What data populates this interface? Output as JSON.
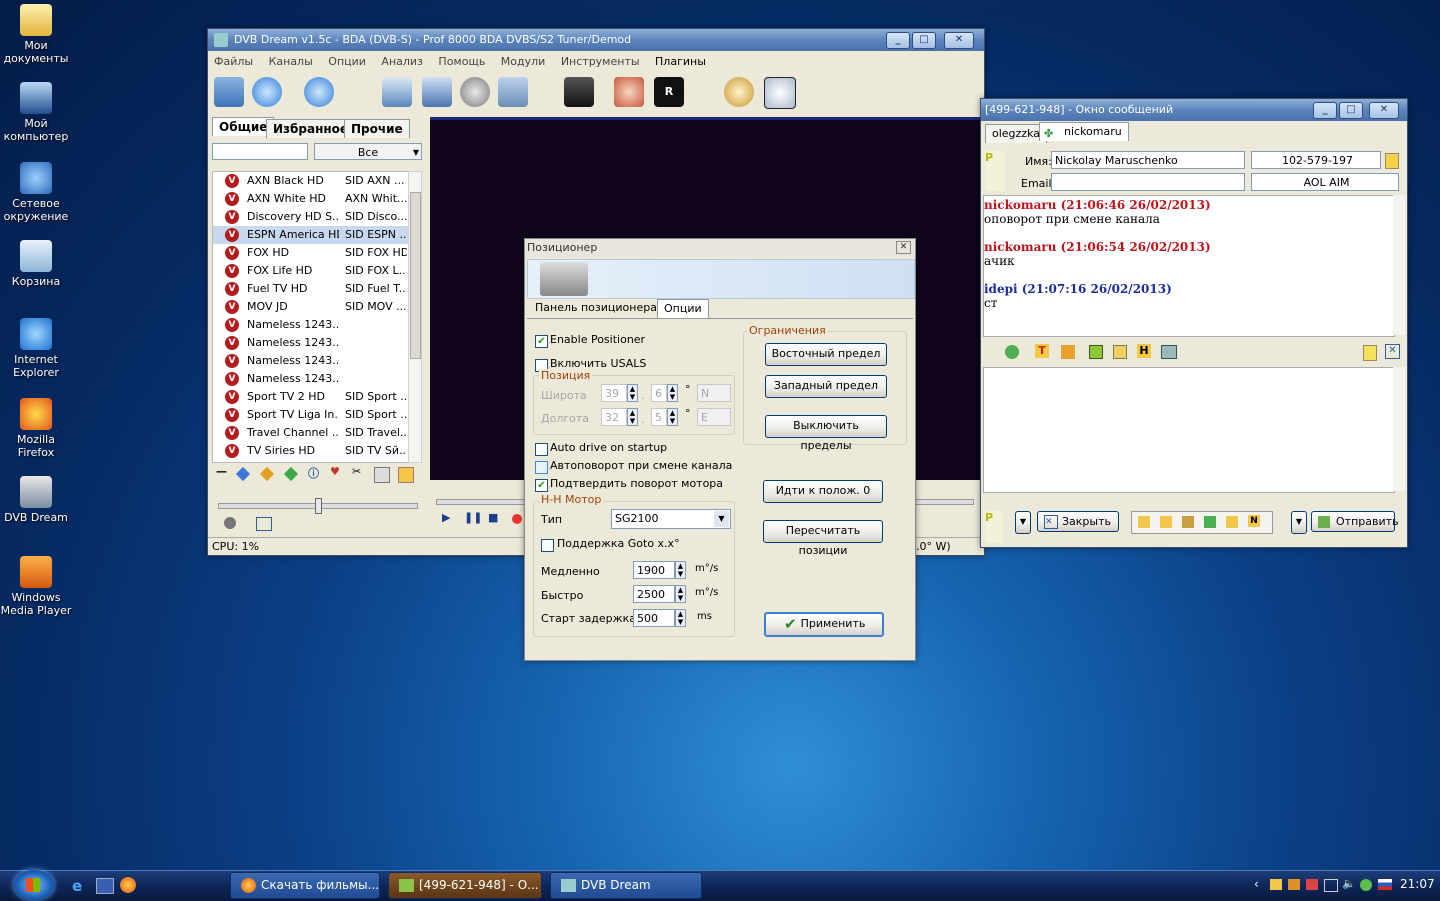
{
  "desktop": {
    "icons": [
      {
        "label": "Мои документы",
        "icon": "folder-icon"
      },
      {
        "label": "Мой компьютер",
        "icon": "computer-icon"
      },
      {
        "label": "Сетевое окружение",
        "icon": "network-icon"
      },
      {
        "label": "Корзина",
        "icon": "recycle-bin-icon"
      },
      {
        "label": "Internet Explorer",
        "icon": "internet-explorer-icon"
      },
      {
        "label": "Mozilla Firefox",
        "icon": "firefox-icon"
      },
      {
        "label": "DVB Dream",
        "icon": "satellite-icon"
      },
      {
        "label": "Windows Media Player",
        "icon": "media-player-icon"
      }
    ]
  },
  "dvb": {
    "title": "DVB Dream v1.5c - BDA (DVB-S) - Prof 8000 BDA DVBS/S2 Tuner/Demod",
    "menu": [
      "Файлы",
      "Каналы",
      "Опции",
      "Анализ",
      "Помощь",
      "Модули",
      "Инструменты",
      "Плагины"
    ],
    "tabs": [
      "Общие",
      "Избранное",
      "Прочие"
    ],
    "filter_value": "Все",
    "channels": [
      {
        "name": "AXN Black HD",
        "sid": "SID AXN ..."
      },
      {
        "name": "AXN White HD",
        "sid": "AXN Whit..."
      },
      {
        "name": "Discovery HD S...",
        "sid": "SID Disco..."
      },
      {
        "name": "ESPN America HD",
        "sid": "SID ESPN ..."
      },
      {
        "name": "FOX HD",
        "sid": "SID FOX HD"
      },
      {
        "name": "FOX Life HD",
        "sid": "SID FOX L..."
      },
      {
        "name": "Fuel TV HD",
        "sid": "SID Fuel T..."
      },
      {
        "name": "MOV JD",
        "sid": "SID MOV ..."
      },
      {
        "name": "Nameless 1243...",
        "sid": ""
      },
      {
        "name": "Nameless 1243...",
        "sid": ""
      },
      {
        "name": "Nameless 1243...",
        "sid": ""
      },
      {
        "name": "Nameless 1243...",
        "sid": ""
      },
      {
        "name": "Sport TV 2 HD",
        "sid": "SID Sport ..."
      },
      {
        "name": "Sport TV Liga In...",
        "sid": "SID Sport ..."
      },
      {
        "name": "Travel Channel ...",
        "sid": "SID Travel..."
      },
      {
        "name": "TV Siries HD",
        "sid": "SID TV Sй..."
      }
    ],
    "selected_index": 3,
    "status_cpu": "CPU: 1%",
    "status_right": ".0° W)"
  },
  "positioner": {
    "title": "Позиционер",
    "tabs": [
      "Панель позиционера",
      "Опции"
    ],
    "enable_positioner": "Enable Positioner",
    "usals": "Включить USALS",
    "position_group": "Позиция",
    "lat_label": "Широта",
    "lat_deg": "39",
    "lat_min": "6",
    "lat_dir": "N",
    "lon_label": "Долгота",
    "lon_deg": "32",
    "lon_min": "5",
    "lon_dir": "E",
    "deg_sign": "°",
    "limits_group": "Ограничения",
    "east_limit": "Восточный предел",
    "west_limit": "Западный предел",
    "disable_limits": "Выключить пределы",
    "auto_drive": "Auto drive on startup",
    "autorotate": "Автоповорот при смене канала",
    "confirm_rotate": "Подтвердить поворот мотора",
    "goto_zero": "Идти к полож. 0",
    "hh_group": "H-H Мотор",
    "type_label": "Тип",
    "type_value": "SG2100",
    "goto_support": "Поддержка Goto x.x°",
    "recalc": "Пересчитать позиции",
    "slow_label": "Медленно",
    "slow_value": "1900",
    "fast_label": "Быстро",
    "fast_value": "2500",
    "unit_speed": "m°/s",
    "delay_label": "Старт задержка",
    "delay_value": "500",
    "unit_ms": "ms",
    "apply": "Применить"
  },
  "chat": {
    "title": "[499-621-948] - Окно сообщений",
    "tab_left": "olegzzka",
    "tab_active": "nickomaru",
    "name_label": "Имя:",
    "name_value": "Nickolay  Maruschenko",
    "uin": "102-579-197",
    "email_label": "Email:",
    "email_value": "",
    "protocol": "AOL AIM",
    "messages": [
      {
        "head": "nickomaru (21:06:46 26/02/2013)",
        "text": "оповорот при смене канала",
        "color": "#c0141c"
      },
      {
        "head": "nickomaru (21:06:54 26/02/2013)",
        "text": "ачик",
        "color": "#c0141c"
      },
      {
        "head": "idepi (21:07:16 26/02/2013)",
        "text": "ст",
        "color": "#1c2c9c"
      }
    ],
    "close_btn": "Закрыть",
    "send_btn": "Отправить"
  },
  "taskbar": {
    "tasks": [
      "Скачать фильмы...",
      "[499-621-948] - О...",
      "DVB Dream"
    ],
    "clock": "21:07"
  }
}
